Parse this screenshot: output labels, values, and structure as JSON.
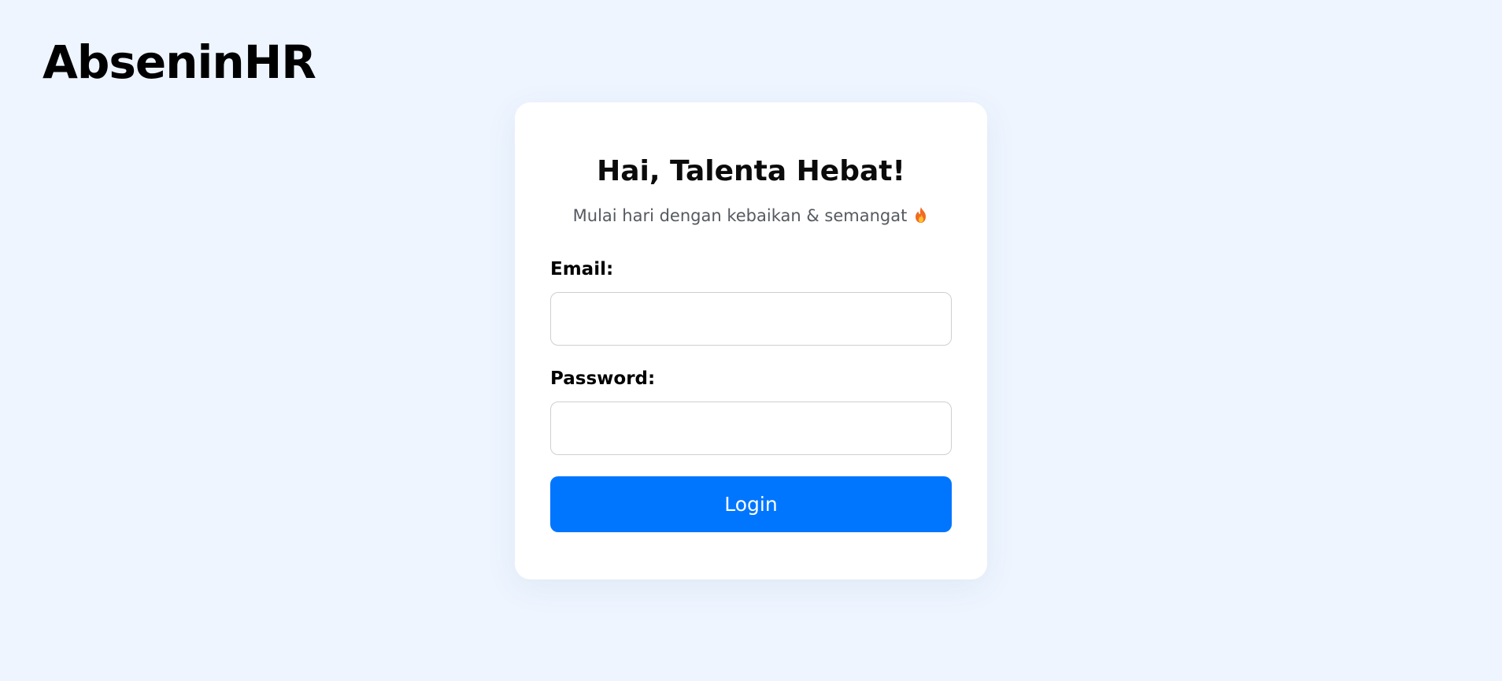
{
  "app": {
    "brand": "AbseninHR"
  },
  "login": {
    "title": "Hai, Talenta Hebat!",
    "subtitle": "Mulai hari dengan kebaikan & semangat",
    "subtitle_icon": "fire-emoji",
    "email_label": "Email:",
    "email_value": "",
    "password_label": "Password:",
    "password_value": "",
    "login_label": "Login"
  },
  "colors": {
    "page_background": "#eef5ff",
    "card_background": "#ffffff",
    "primary": "#0076ff",
    "muted_text": "#555a60",
    "field_border": "#cfcfcf"
  }
}
